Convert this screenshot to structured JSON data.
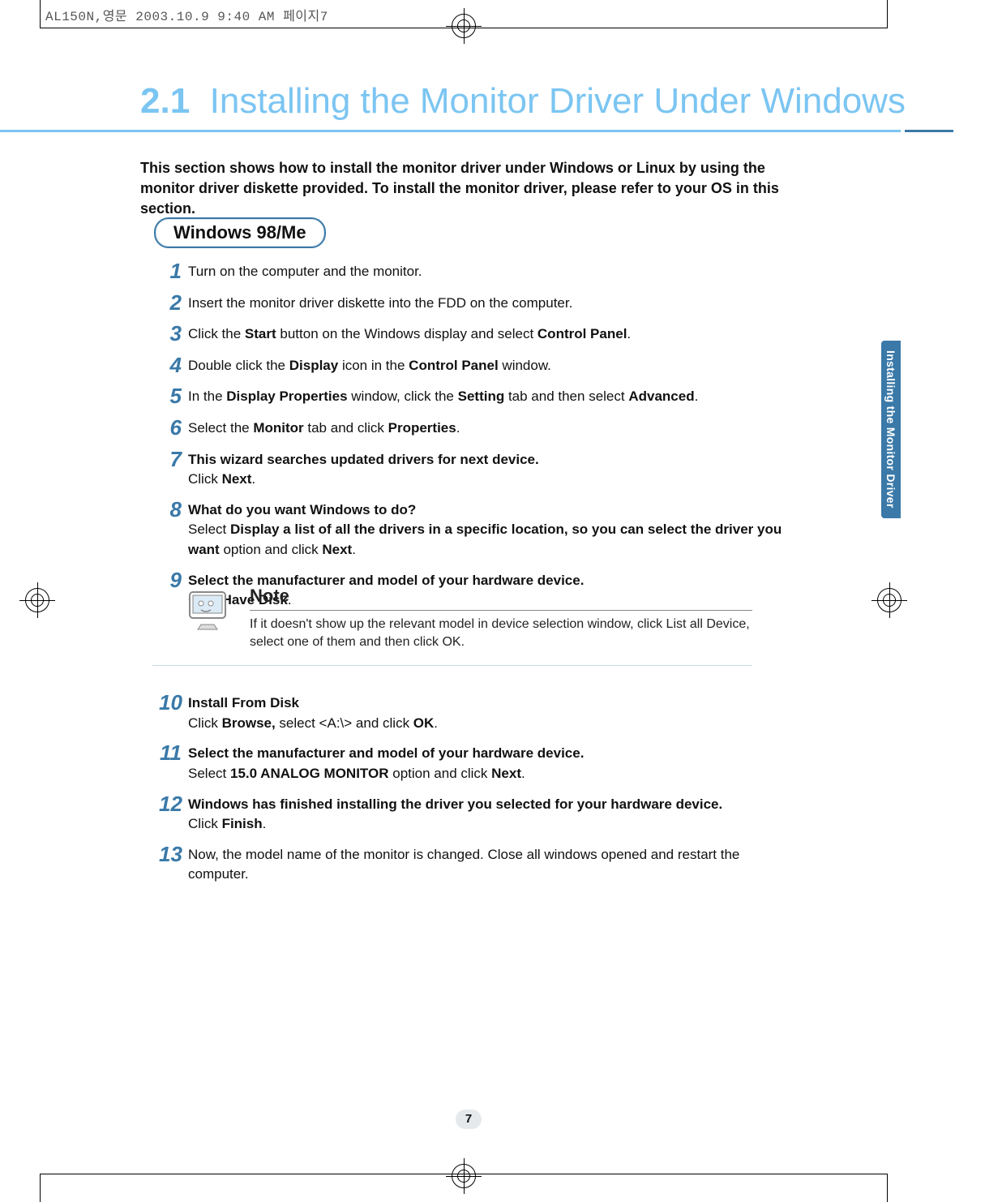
{
  "header_info": "AL150N,영문  2003.10.9 9:40 AM  페이지7",
  "title": {
    "number": "2.1",
    "text": "Installing the Monitor Driver Under Windows"
  },
  "intro": "This section shows how to install the monitor driver under Windows or Linux by using the monitor driver diskette provided. To install the monitor driver, please refer to your OS in this section.",
  "section_tag": "Windows 98/Me",
  "side_tab": "Installing the Monitor Driver",
  "page_number": "7",
  "steps_a": [
    {
      "n": "1",
      "html": "Turn on the computer and the monitor."
    },
    {
      "n": "2",
      "html": "Insert the monitor driver diskette into the FDD on the computer."
    },
    {
      "n": "3",
      "html": "Click the <b>Start</b> button on the Windows display and select <b>Control Panel</b>."
    },
    {
      "n": "4",
      "html": "Double click the <b>Display</b> icon in the <b>Control Panel</b> window."
    },
    {
      "n": "5",
      "html": "In the <b>Display Properties</b> window, click the <b>Setting</b> tab and then select <b>Advanced</b>."
    },
    {
      "n": "6",
      "html": "Select the <b>Monitor</b> tab and click <b>Properties</b>."
    },
    {
      "n": "7",
      "html": "<b>This wizard searches updated drivers for next device.</b><br>Click <b>Next</b>."
    },
    {
      "n": "8",
      "html": "<b>What do you want Windows to do?</b><br>Select <b>Display a list of all the drivers in a specific location, so you can select the driver you want</b> option and click <b>Next</b>."
    },
    {
      "n": "9",
      "html": "<b>Select the manufacturer and model of your hardware device.</b><br>Click <b>Have Disk</b>."
    }
  ],
  "note": {
    "title": "Note",
    "text": "If it doesn't show up the relevant model in device selection window, click List all Device, select one of them and then click OK."
  },
  "steps_b": [
    {
      "n": "10",
      "html": "<b>Install From Disk</b><br>Click <b>Browse,</b> select &lt;A:\\&gt; and click <b>OK</b>."
    },
    {
      "n": "11",
      "html": "<b>Select the manufacturer and model of your hardware device.</b><br>Select <b>15.0 ANALOG MONITOR</b> option and click <b>Next</b>."
    },
    {
      "n": "12",
      "html": "<b>Windows has finished installing the driver you selected for your hardware device.</b><br>Click <b>Finish</b>."
    },
    {
      "n": "13",
      "html": "Now, the model name of the monitor is changed. Close all windows opened and restart the computer."
    }
  ]
}
